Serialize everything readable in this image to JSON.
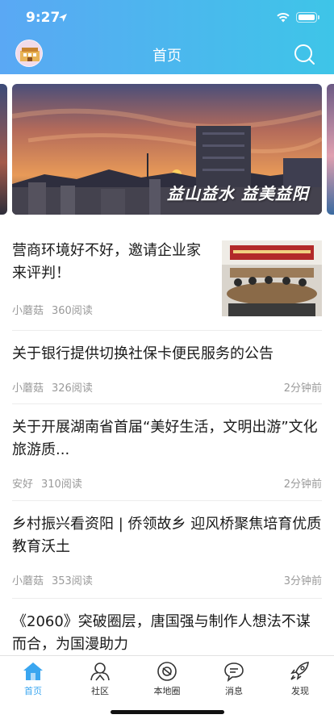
{
  "status_bar": {
    "time": "9:27"
  },
  "header": {
    "title": "首页"
  },
  "banner": {
    "caption": "益山益水 益美益阳"
  },
  "articles": [
    {
      "title": "营商环境好不好，邀请企业家来评判！",
      "author": "小蘑菇",
      "reads": "360阅读",
      "time": ""
    },
    {
      "title": "关于银行提供切换社保卡便民服务的公告",
      "author": "小蘑菇",
      "reads": "326阅读",
      "time": "2分钟前"
    },
    {
      "title": "关于开展湖南省首届“美好生活，文明出游”文化旅游质...",
      "author": "安好",
      "reads": "310阅读",
      "time": "2分钟前"
    },
    {
      "title": "乡村振兴看资阳 | 侨领故乡 迎风桥聚焦培育优质教育沃土",
      "author": "小蘑菇",
      "reads": "353阅读",
      "time": "3分钟前"
    },
    {
      "title": "《2060》突破圈层，唐国强与制作人想法不谋而合，为国漫助力"
    }
  ],
  "tabbar": {
    "items": [
      {
        "label": "首页",
        "icon": "home-icon"
      },
      {
        "label": "社区",
        "icon": "community-icon"
      },
      {
        "label": "本地圈",
        "icon": "local-circle-icon"
      },
      {
        "label": "消息",
        "icon": "message-icon"
      },
      {
        "label": "发现",
        "icon": "discover-icon"
      }
    ],
    "active_color": "#3aa6f0"
  },
  "theme": {
    "header_gradient_start": "#5aa8f4",
    "header_gradient_end": "#3ec5e8"
  }
}
